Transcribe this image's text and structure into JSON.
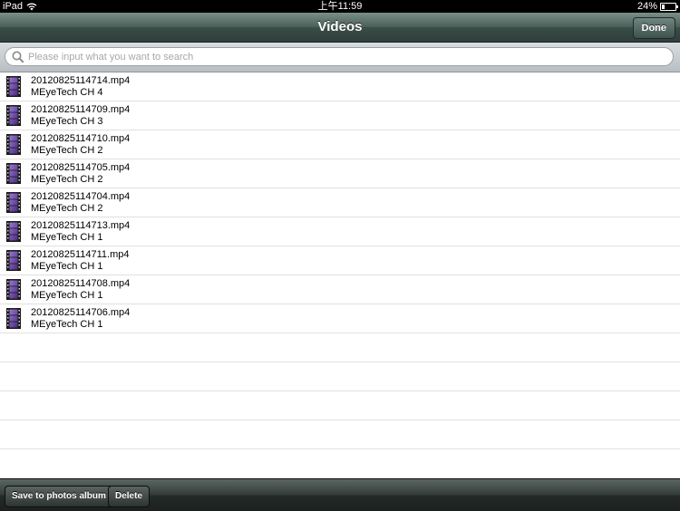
{
  "status_bar": {
    "device": "iPad",
    "time": "上午11:59",
    "battery_text": "24%",
    "battery_level": 0.24
  },
  "nav": {
    "title": "Videos",
    "done_label": "Done"
  },
  "search": {
    "placeholder": "Please input what you want to search",
    "value": ""
  },
  "files": [
    {
      "name": "20120825114714.mp4",
      "channel": "MEyeTech CH 4"
    },
    {
      "name": "20120825114709.mp4",
      "channel": "MEyeTech CH 3"
    },
    {
      "name": "20120825114710.mp4",
      "channel": "MEyeTech CH 2"
    },
    {
      "name": "20120825114705.mp4",
      "channel": "MEyeTech CH 2"
    },
    {
      "name": "20120825114704.mp4",
      "channel": "MEyeTech CH 2"
    },
    {
      "name": "20120825114713.mp4",
      "channel": "MEyeTech CH 1"
    },
    {
      "name": "20120825114711.mp4",
      "channel": "MEyeTech CH 1"
    },
    {
      "name": "20120825114708.mp4",
      "channel": "MEyeTech CH 1"
    },
    {
      "name": "20120825114706.mp4",
      "channel": "MEyeTech CH 1"
    }
  ],
  "empty_rows": 5,
  "toolbar": {
    "save_label": "Save to photos album",
    "delete_label": "Delete"
  },
  "icons": {
    "file": "film-strip-icon",
    "search": "search-icon",
    "wifi": "wifi-icon",
    "battery": "battery-icon"
  },
  "colors": {
    "navbar": "#4a5e58",
    "film_icon": "#6b3fa0"
  }
}
